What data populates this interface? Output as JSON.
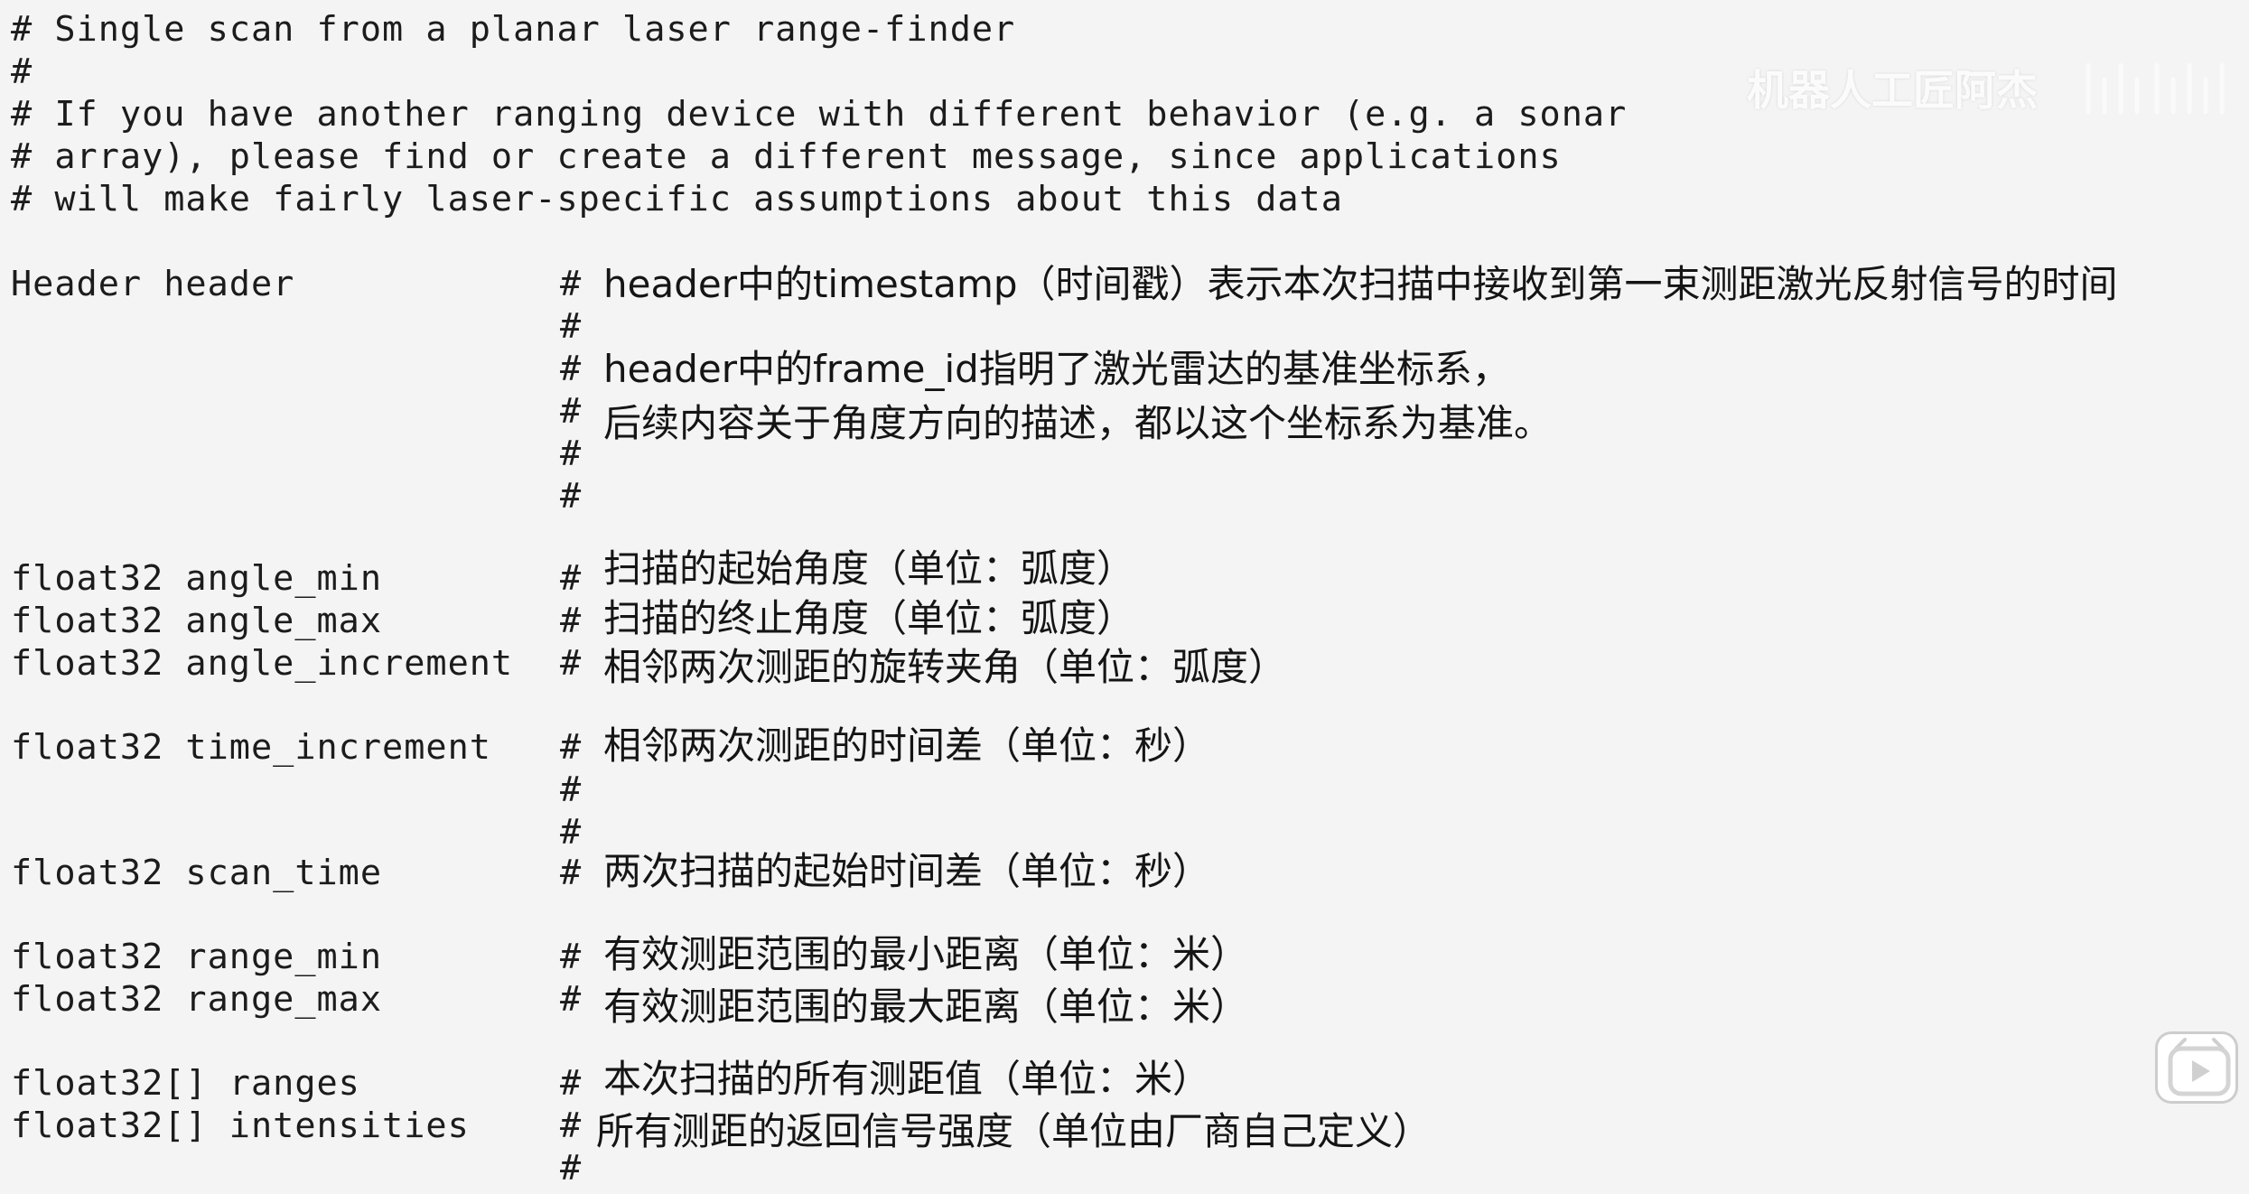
{
  "watermark": "机器人工匠阿杰",
  "icons": {
    "play": "play-icon",
    "logo": "bilibili-logo-icon"
  },
  "code": {
    "comments": [
      "# Single scan from a planar laser range-finder",
      "#",
      "# If you have another ranging device with different behavior (e.g. a sonar",
      "# array), please find or create a different message, since applications",
      "# will make fairly laser-specific assumptions about this data"
    ],
    "fields": {
      "header": "Header header",
      "angle_min": "float32 angle_min",
      "angle_max": "float32 angle_max",
      "angle_increment": "float32 angle_increment",
      "time_increment": "float32 time_increment",
      "scan_time": "float32 scan_time",
      "range_min": "float32 range_min",
      "range_max": "float32 range_max",
      "ranges": "float32[] ranges",
      "intensities": "float32[] intensities"
    },
    "hash": "#",
    "annotations": {
      "header_1": "header中的timestamp（时间戳）表示本次扫描中接收到第一束测距激光反射信号的时间",
      "header_2": "header中的frame_id指明了激光雷达的基准坐标系，",
      "header_3": "后续内容关于角度方向的描述，都以这个坐标系为基准。",
      "angle_min": "扫描的起始角度（单位：弧度）",
      "angle_max": "扫描的终止角度（单位：弧度）",
      "angle_increment": "相邻两次测距的旋转夹角（单位：弧度）",
      "time_increment": "相邻两次测距的时间差（单位：秒）",
      "scan_time": "两次扫描的起始时间差（单位：秒）",
      "range_min": "有效测距范围的最小距离（单位：米）",
      "range_max": "有效测距范围的最大距离（单位：米）",
      "ranges": "本次扫描的所有测距值（单位：米）",
      "intensities": "所有测距的返回信号强度（单位由厂商自己定义）"
    }
  }
}
